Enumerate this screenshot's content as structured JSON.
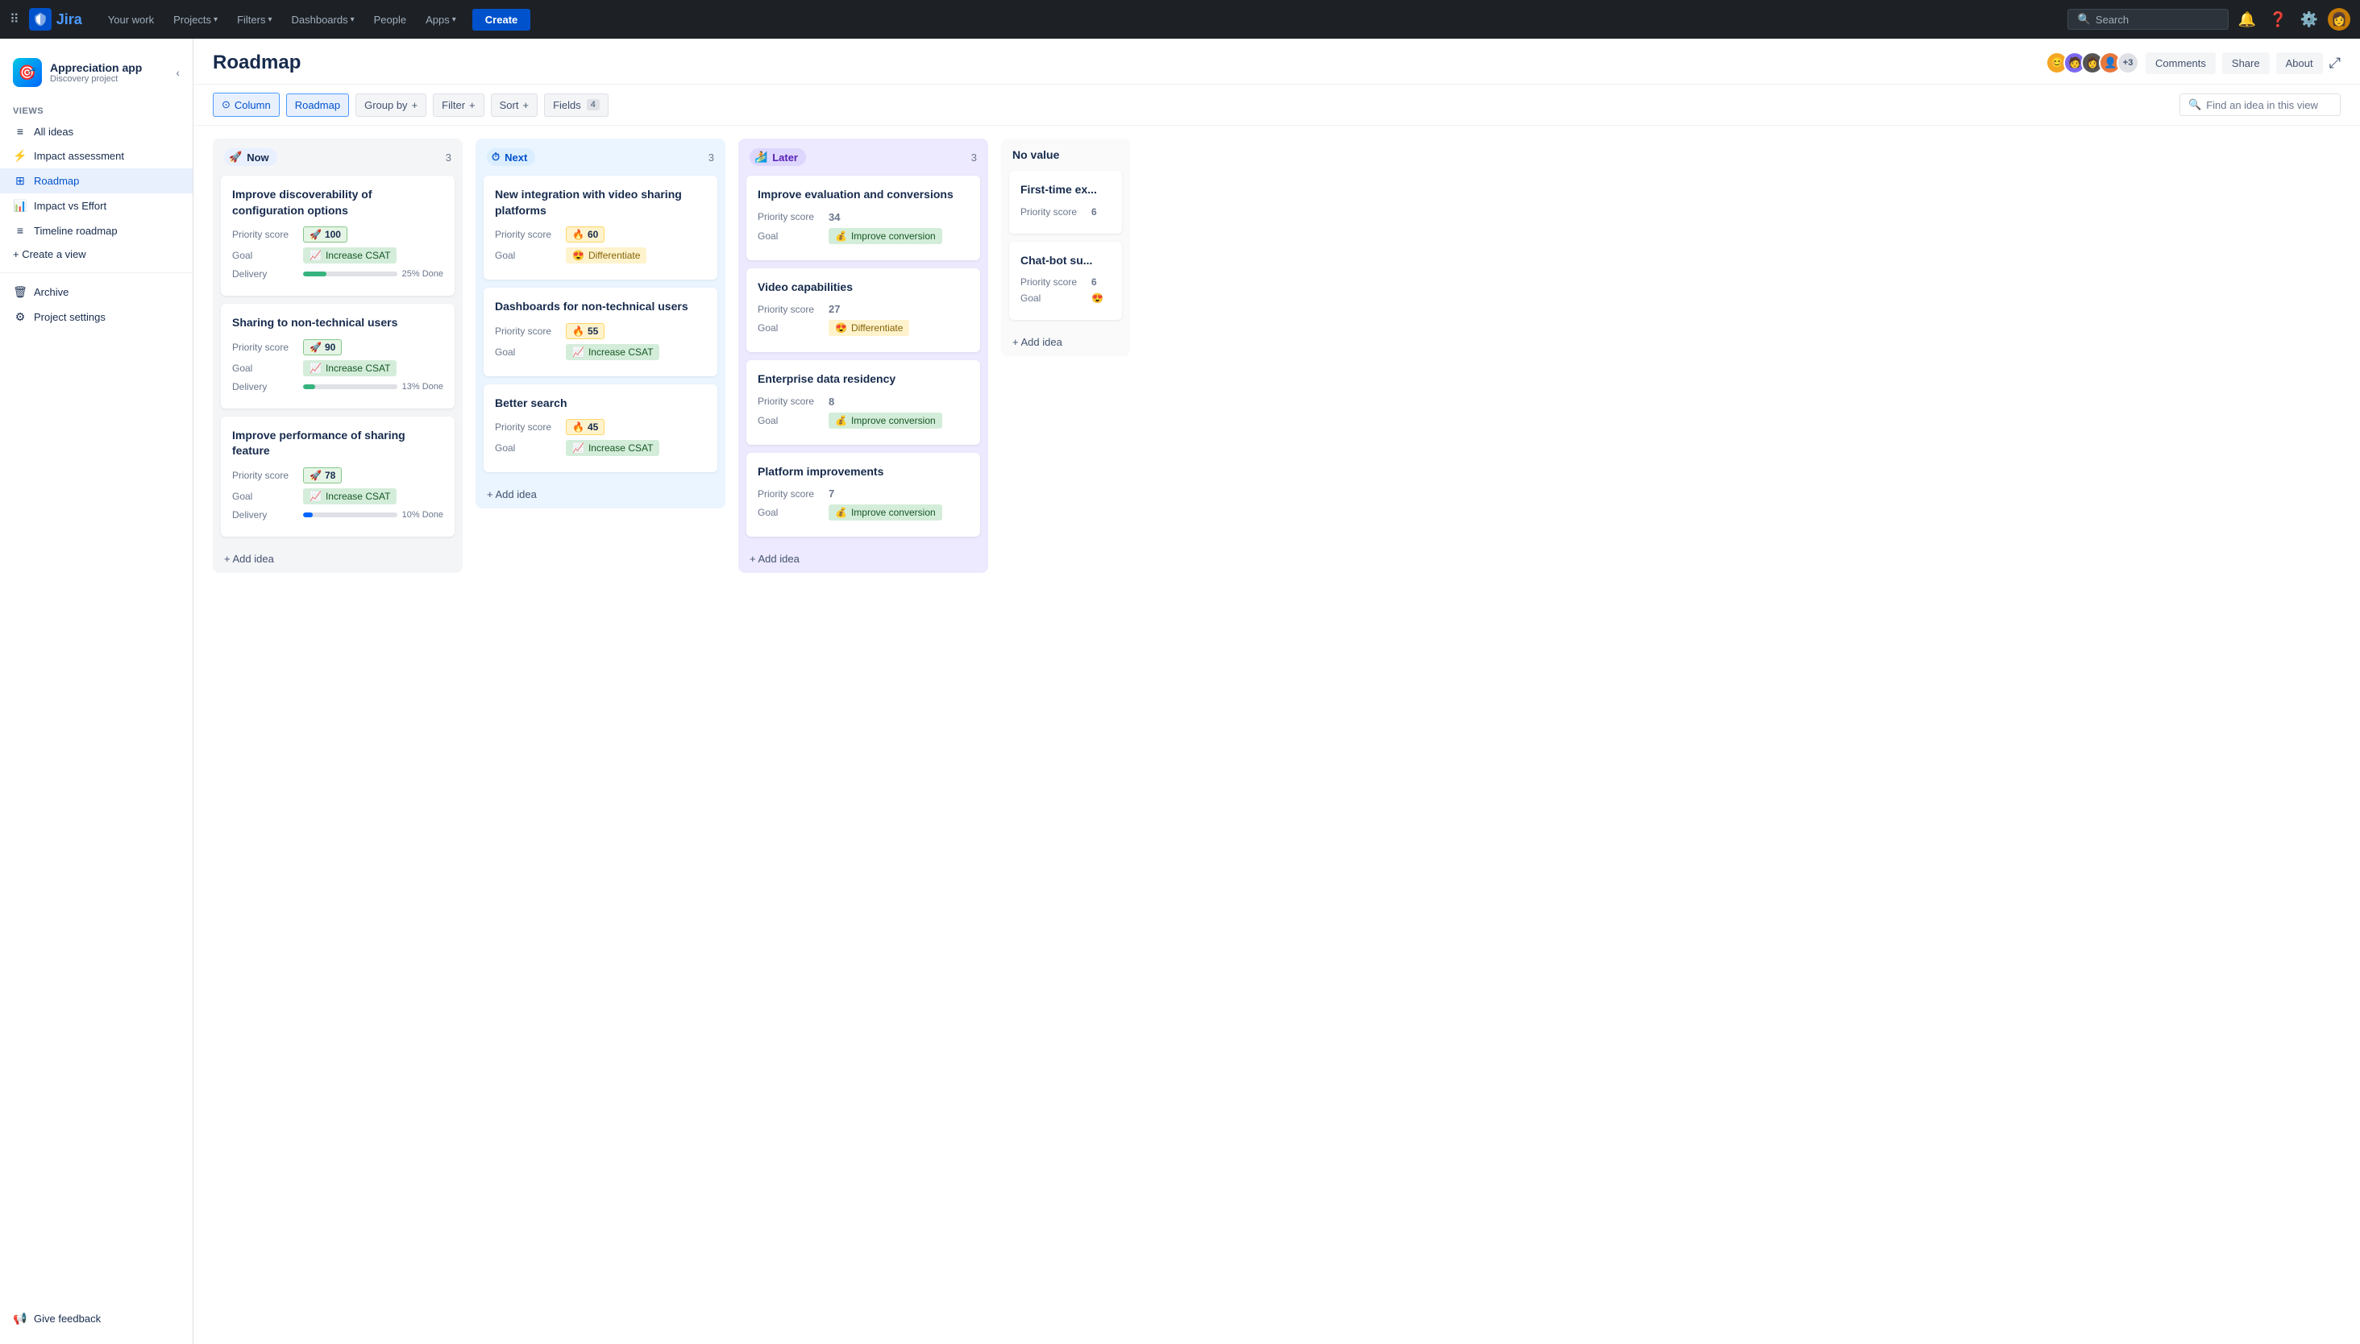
{
  "nav": {
    "your_work": "Your work",
    "projects": "Projects",
    "filters": "Filters",
    "dashboards": "Dashboards",
    "people": "People",
    "apps": "Apps",
    "create": "Create",
    "search_placeholder": "Search"
  },
  "sidebar": {
    "project_name": "Appreciation app",
    "project_type": "Discovery project",
    "views_label": "VIEWS",
    "items": [
      {
        "id": "all-ideas",
        "label": "All ideas",
        "icon": "≡"
      },
      {
        "id": "impact-assessment",
        "label": "Impact assessment",
        "icon": "⚡"
      },
      {
        "id": "roadmap",
        "label": "Roadmap",
        "icon": "⊞",
        "active": true
      },
      {
        "id": "impact-vs-effort",
        "label": "Impact vs Effort",
        "icon": "📊"
      },
      {
        "id": "timeline-roadmap",
        "label": "Timeline roadmap",
        "icon": "≡"
      }
    ],
    "create_view": "+ Create a view",
    "archive": "Archive",
    "project_settings": "Project settings",
    "give_feedback": "Give feedback"
  },
  "page": {
    "title": "Roadmap",
    "comments": "Comments",
    "share": "Share",
    "about": "About"
  },
  "toolbar": {
    "column_label": "Column",
    "roadmap_label": "Roadmap",
    "group_by_label": "Group by",
    "filter_label": "Filter",
    "sort_label": "Sort",
    "fields_label": "Fields",
    "fields_count": "4",
    "search_placeholder": "Find an idea in this view"
  },
  "columns": [
    {
      "id": "now",
      "title": "Now",
      "icon": "🚀",
      "count": 3,
      "theme": "now",
      "cards": [
        {
          "title": "Improve discoverability of configuration options",
          "priority_score_label": "Priority score",
          "priority_score": "100",
          "score_icon": "🚀",
          "goal_label": "Goal",
          "goal": "Increase CSAT",
          "goal_icon": "📈",
          "goal_type": "increase",
          "delivery_label": "Delivery",
          "delivery_pct": 25,
          "delivery_text": "25% Done"
        },
        {
          "title": "Sharing to non-technical users",
          "priority_score_label": "Priority score",
          "priority_score": "90",
          "score_icon": "🚀",
          "goal_label": "Goal",
          "goal": "Increase CSAT",
          "goal_icon": "📈",
          "goal_type": "increase",
          "delivery_label": "Delivery",
          "delivery_pct": 13,
          "delivery_text": "13% Done"
        },
        {
          "title": "Improve performance of sharing feature",
          "priority_score_label": "Priority score",
          "priority_score": "78",
          "score_icon": "🚀",
          "goal_label": "Goal",
          "goal": "Increase CSAT",
          "goal_icon": "📈",
          "goal_type": "increase",
          "delivery_label": "Delivery",
          "delivery_pct": 10,
          "delivery_text": "10% Done"
        }
      ]
    },
    {
      "id": "next",
      "title": "Next",
      "icon": "⏱",
      "count": 3,
      "theme": "next",
      "cards": [
        {
          "title": "New integration with video sharing platforms",
          "priority_score_label": "Priority score",
          "priority_score": "60",
          "score_icon": "🔥",
          "goal_label": "Goal",
          "goal": "Differentiate",
          "goal_icon": "😍",
          "goal_type": "differentiate"
        },
        {
          "title": "Dashboards for non-technical users",
          "priority_score_label": "Priority score",
          "priority_score": "55",
          "score_icon": "🔥",
          "goal_label": "Goal",
          "goal": "Increase CSAT",
          "goal_icon": "📈",
          "goal_type": "increase"
        },
        {
          "title": "Better search",
          "priority_score_label": "Priority score",
          "priority_score": "45",
          "score_icon": "🔥",
          "goal_label": "Goal",
          "goal": "Increase CSAT",
          "goal_icon": "📈",
          "goal_type": "increase"
        }
      ]
    },
    {
      "id": "later",
      "title": "Later",
      "icon": "🏄",
      "count": 3,
      "theme": "later",
      "cards": [
        {
          "title": "Improve evaluation and conversions",
          "priority_score_label": "Priority score",
          "priority_score": "34",
          "goal_label": "Goal",
          "goal": "Improve conversion",
          "goal_icon": "💰",
          "goal_type": "conversion"
        },
        {
          "title": "Video capabilities",
          "priority_score_label": "Priority score",
          "priority_score": "27",
          "goal_label": "Goal",
          "goal": "Differentiate",
          "goal_icon": "😍",
          "goal_type": "differentiate"
        },
        {
          "title": "Enterprise data residency",
          "priority_score_label": "Priority score",
          "priority_score": "8",
          "goal_label": "Goal",
          "goal": "Improve conversion",
          "goal_icon": "💰",
          "goal_type": "conversion"
        },
        {
          "title": "Platform improvements",
          "priority_score_label": "Priority score",
          "priority_score": "7",
          "goal_label": "Goal",
          "goal": "Improve conversion",
          "goal_icon": "💰",
          "goal_type": "conversion"
        }
      ]
    },
    {
      "id": "no-value",
      "title": "No value",
      "count": null,
      "theme": "no-value",
      "cards": [
        {
          "title": "First-time ex...",
          "priority_score_label": "Priority score",
          "priority_score": "6",
          "partial": true
        },
        {
          "title": "Chat-bot su...",
          "priority_score_label": "Priority score",
          "priority_score": "6",
          "partial": true,
          "goal_label": "Goal",
          "goal_icon": "😍"
        }
      ]
    }
  ],
  "add_idea": "+ Add idea",
  "avatars": [
    {
      "color": "#f5a623",
      "emoji": "😊"
    },
    {
      "color": "#7b68ee",
      "emoji": "🧑"
    },
    {
      "color": "#4a4a4a",
      "emoji": "👩"
    },
    {
      "color": "#e8773c",
      "emoji": "👤"
    }
  ],
  "avatar_count": "+3"
}
